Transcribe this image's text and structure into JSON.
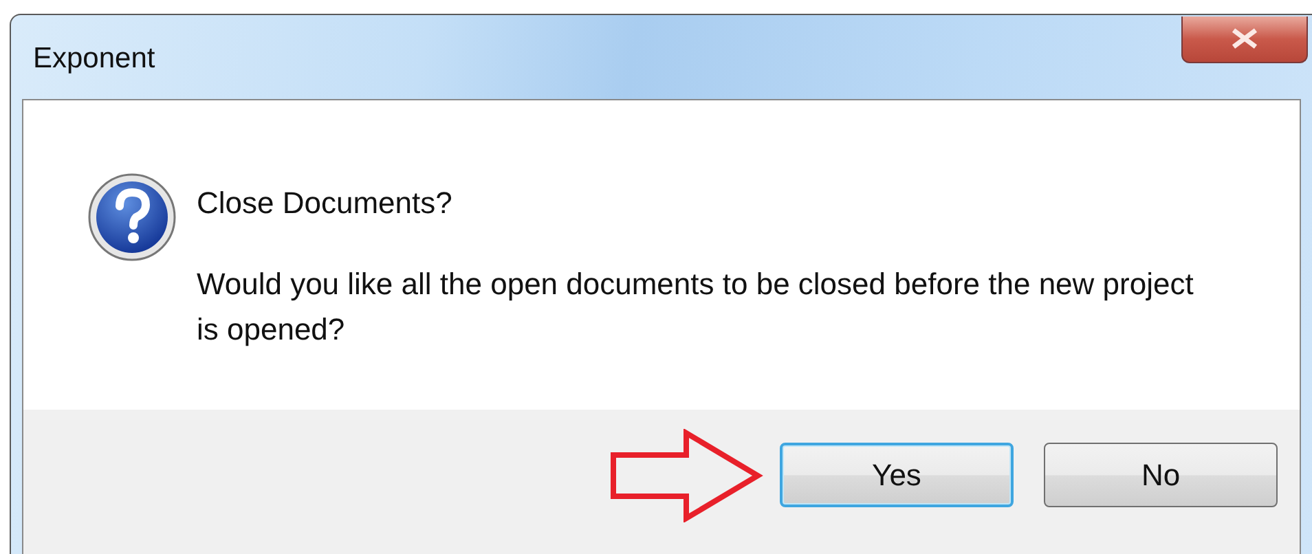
{
  "window": {
    "title": "Exponent"
  },
  "message": {
    "heading": "Close Documents?",
    "body": "Would you like all the open documents to be closed before the new project is opened?"
  },
  "buttons": [
    {
      "label": "Yes",
      "default": true
    },
    {
      "label": "No",
      "default": false
    }
  ]
}
